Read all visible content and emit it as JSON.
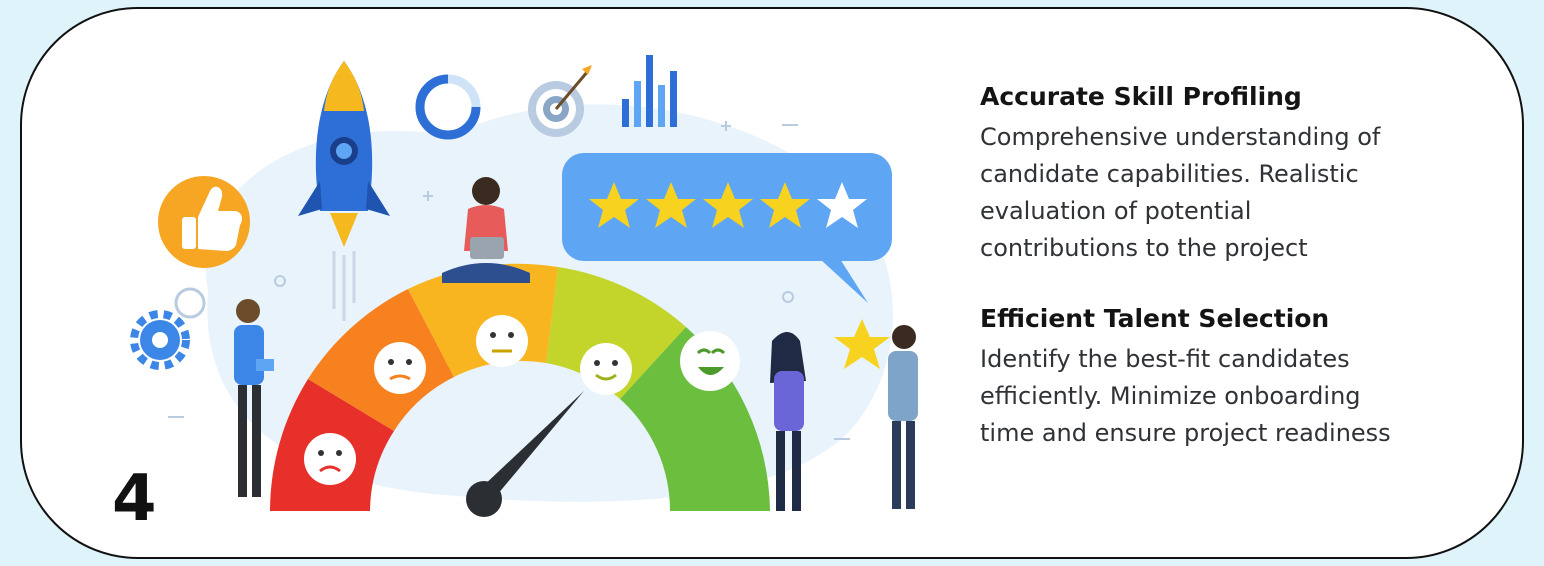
{
  "step": {
    "number": "4"
  },
  "illustration": {
    "icon_names": [
      "thumbs-up-icon",
      "rocket-icon",
      "donut-chart-icon",
      "target-icon",
      "bar-chart-icon",
      "gear-icon",
      "star-rating-icon",
      "satisfaction-gauge-icon"
    ],
    "rating": {
      "filled_stars": 4,
      "total_stars": 5
    },
    "gauge_colors": [
      "#e8302a",
      "#f7811e",
      "#f9b51f",
      "#c3d42a",
      "#6cbe3f"
    ]
  },
  "sections": [
    {
      "title": "Accurate Skill Profiling",
      "lines": [
        "Comprehensive understanding of",
        "candidate capabilities. Realistic",
        "evaluation of potential",
        "contributions to the project"
      ]
    },
    {
      "title": "Efficient Talent Selection",
      "lines": [
        "Identify the best-fit candidates",
        "efficiently. Minimize onboarding",
        "time and ensure project readiness"
      ]
    }
  ]
}
